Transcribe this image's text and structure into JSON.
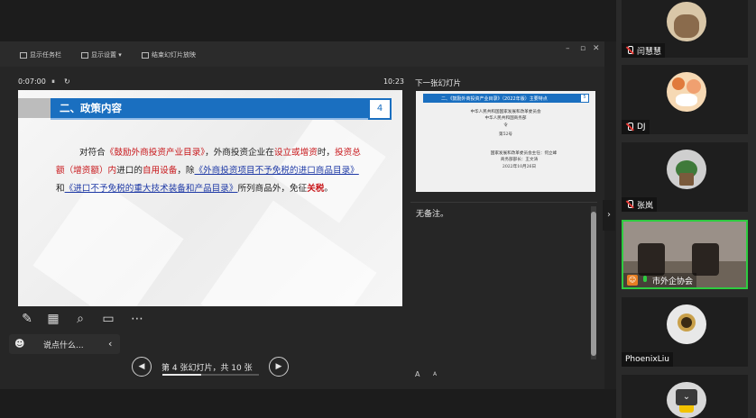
{
  "toolbar": {
    "taskbar_label": "显示任务栏",
    "display_settings_label": "显示设置 ▾",
    "end_show_label": "结束幻灯片放映"
  },
  "presenter": {
    "elapsed_time": "0:07:00",
    "clock": "10:23",
    "next_slide_label": "下一张幻灯片",
    "notes_text": "无备注。",
    "chat_placeholder": "说点什么...",
    "slide_counter": "第 4 张幻灯片，共 10 张",
    "progress_fraction": 0.4,
    "font_up": "A",
    "font_down": "A"
  },
  "slide": {
    "title": "二、政策内容",
    "number": "4",
    "body": {
      "p1": "对符合",
      "catalog": "《鼓励外商投资产业目录》",
      "p2": "，外商投资企业在",
      "setup": "设立或增资",
      "p3": "时，",
      "total": "投资总额（增资额）内",
      "p4": "进口的",
      "self_use": "自用设备",
      "p5": "，除",
      "link1": "《外商投资项目不予免税的进口商品目录》",
      "p6": "和",
      "link2": "《进口不予免税的重大技术装备和产品目录》",
      "p7": "所列商品外，免征",
      "tariff": "关税",
      "p8": "。"
    }
  },
  "next_slide": {
    "title": "二、《鼓励外商投资产业目录》（2022年版）主要特点",
    "number": "5",
    "line1": "中华人民共和国国家发展和改革委员会",
    "line2": "中华人民共和国商务部",
    "line3": "令",
    "line4": "第52号",
    "line5": "国家发展和改革委员会主任：何立峰",
    "line6": "商务部部长：王文涛",
    "line7": "2022年10月26日"
  },
  "participants": [
    {
      "name": "闫慧慧",
      "mic": "off"
    },
    {
      "name": "DJ",
      "mic": "off"
    },
    {
      "name": "张岚",
      "mic": "off"
    },
    {
      "name": "市外企协会",
      "mic": "on"
    },
    {
      "name": "PhoenixLiu",
      "mic": "none"
    }
  ],
  "colors": {
    "accent": "#1a6fc0",
    "emphasis_red": "#c8171b",
    "link_blue": "#1f3aa6"
  }
}
